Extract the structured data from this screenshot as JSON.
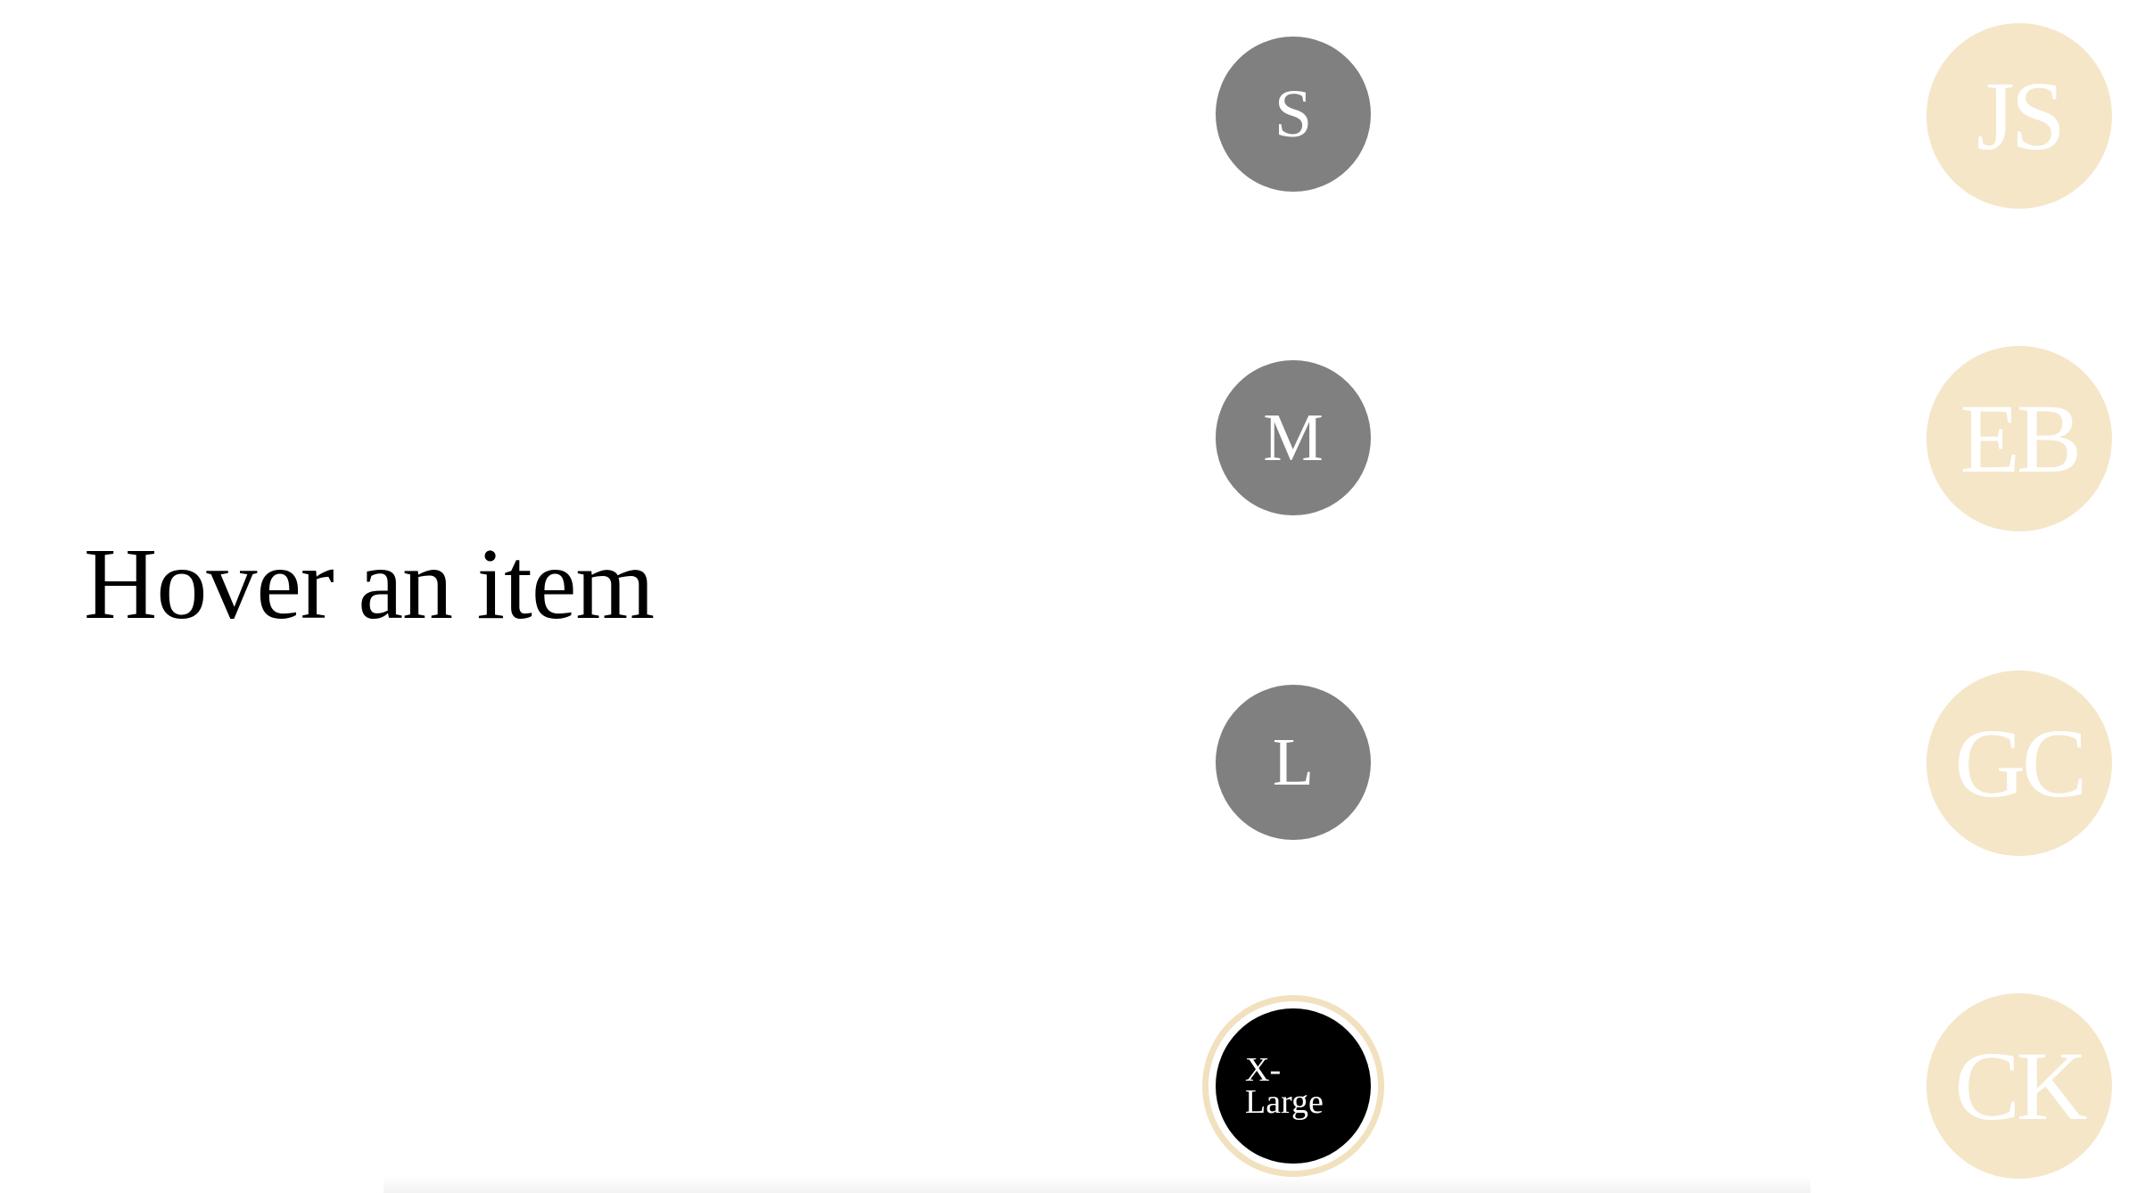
{
  "hover_label": "Hover an item",
  "sizes": {
    "s": "S",
    "m": "M",
    "l": "L",
    "xl_line1": "X-",
    "xl_line2": "Large"
  },
  "avatars": [
    "JS",
    "EB",
    "GC",
    "CK"
  ],
  "colors": {
    "size_default": "#808080",
    "size_selected": "#000000",
    "selected_ring": "#f2e1bf",
    "avatar_bg": "#f5e6c8",
    "text_on_circle": "#ffffff"
  }
}
